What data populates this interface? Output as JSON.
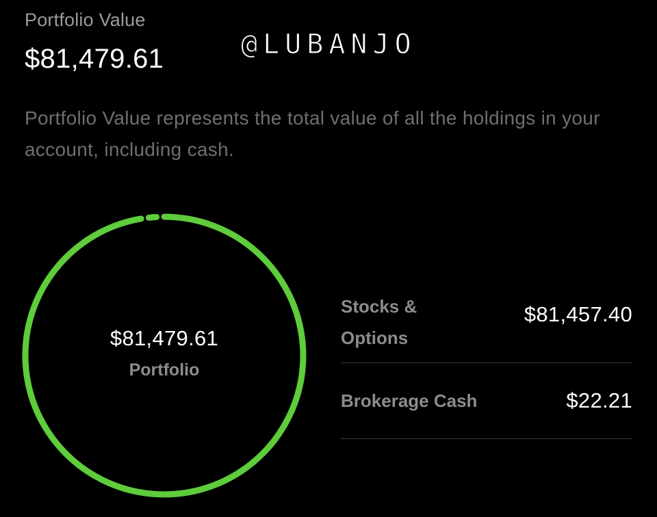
{
  "header": {
    "label": "Portfolio Value",
    "value": "$81,479.61"
  },
  "watermark": "@LUBANJO",
  "description": "Portfolio Value represents the total value of all the holdings in your account, including cash.",
  "donut": {
    "center_value": "$81,479.61",
    "center_label": "Portfolio",
    "ring_color": "#5ecc3b",
    "total": 81479.61,
    "segments": [
      {
        "label": "Stocks & Options",
        "value": 81457.4
      },
      {
        "label": "Brokerage Cash",
        "value": 22.21
      }
    ]
  },
  "breakdown": [
    {
      "label": "Stocks & Options",
      "value": "$81,457.40"
    },
    {
      "label": "Brokerage Cash",
      "value": "$22.21"
    }
  ]
}
